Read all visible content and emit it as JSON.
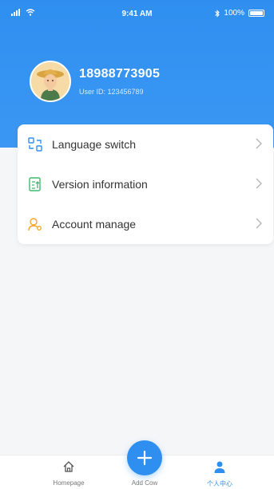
{
  "status_bar": {
    "time": "9:41 AM",
    "battery": "100%"
  },
  "profile": {
    "phone": "18988773905",
    "user_id": "User ID:  123456789"
  },
  "menu": {
    "items": [
      {
        "label": "Language switch",
        "icon": "language-switch-icon"
      },
      {
        "label": "Version information",
        "icon": "version-info-icon"
      },
      {
        "label": "Account manage",
        "icon": "account-manage-icon"
      }
    ]
  },
  "tabbar": {
    "homepage": "Homepage",
    "add_cow": "Add Cow",
    "personal_center": "个人中心"
  },
  "colors": {
    "primary": "#2f8ff0",
    "account_icon": "#f5a623",
    "version_icon": "#3dbb6e"
  }
}
